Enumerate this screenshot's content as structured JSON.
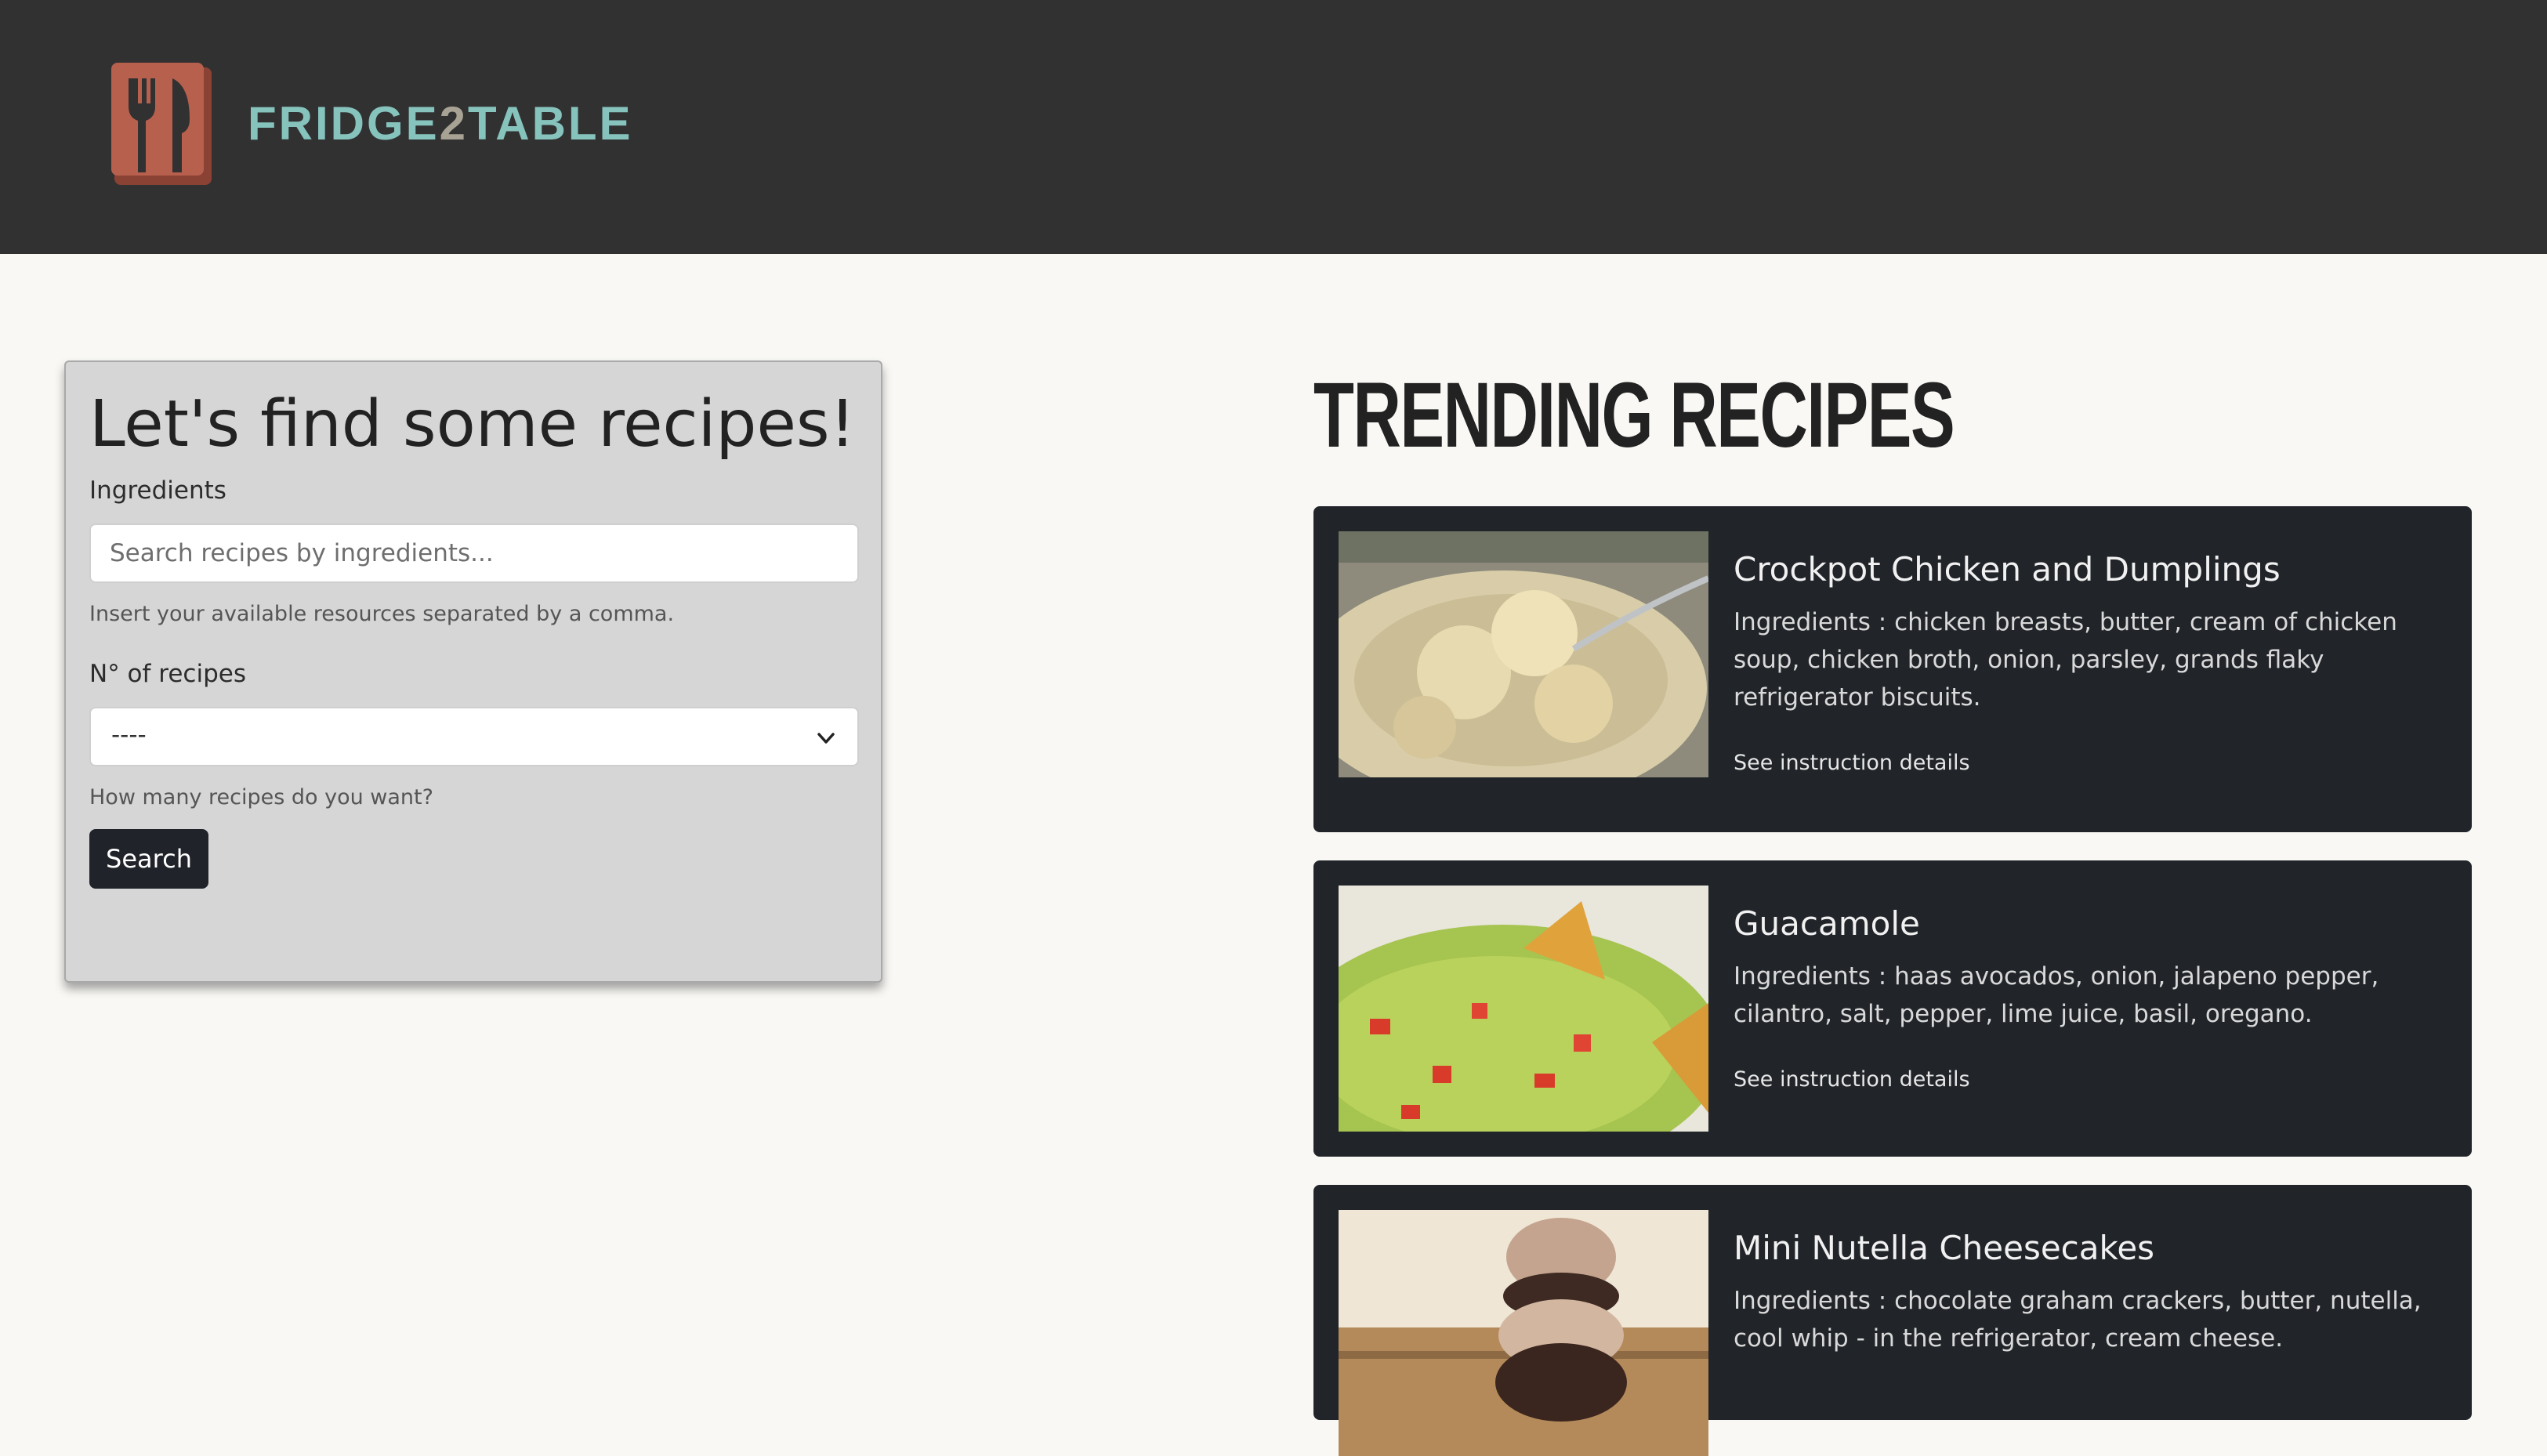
{
  "header": {
    "logo_text_a": "FRIDGE",
    "logo_text_b": "2",
    "logo_text_c": "TABLE",
    "logo_icon": "fork-knife-book-icon",
    "colors": {
      "background": "#313131",
      "logo_teal": "#86c3bd",
      "logo_red": "#b8604e"
    }
  },
  "search_form": {
    "title": "Let's find some recipes!",
    "ingredients_label": "Ingredients",
    "ingredients_placeholder": "Search recipes by ingredients...",
    "ingredients_value": "",
    "ingredients_help": "Insert your available resources separated by a comma.",
    "count_label": "N° of recipes",
    "count_selected": "----",
    "count_help": "How many recipes do you want?",
    "search_label": "Search"
  },
  "trending": {
    "title": "TRENDING RECIPES",
    "recipes": [
      {
        "name": "Crockpot Chicken and Dumplings",
        "ingredients": "Ingredients : chicken breasts, butter, cream of chicken soup, chicken broth, onion, parsley, grands flaky refrigerator biscuits.",
        "link": "See instruction details"
      },
      {
        "name": "Guacamole",
        "ingredients": "Ingredients : haas avocados, onion, jalapeno pepper, cilantro, salt, pepper, lime juice, basil, oregano.",
        "link": "See instruction details"
      },
      {
        "name": "Mini Nutella Cheesecakes",
        "ingredients": "Ingredients : chocolate graham crackers, butter, nutella, cool whip - in the refrigerator, cream cheese.",
        "link": "See instruction details"
      }
    ]
  }
}
